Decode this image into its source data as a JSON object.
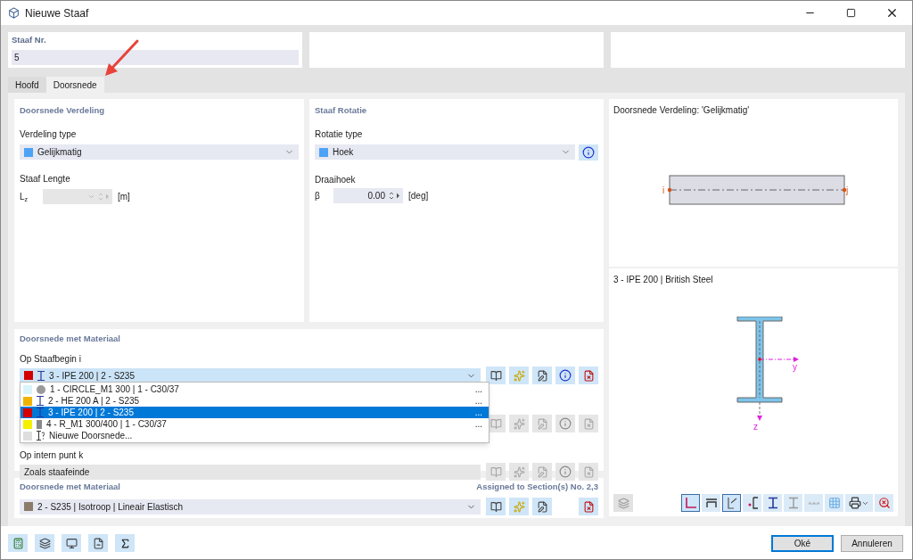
{
  "window": {
    "title": "Nieuwe Staaf"
  },
  "header": {
    "label": "Staaf Nr.",
    "value": "5"
  },
  "tabs": [
    {
      "label": "Hoofd",
      "selected": false
    },
    {
      "label": "Doorsnede",
      "selected": true
    }
  ],
  "distribution": {
    "title": "Doorsnede Verdeling",
    "type_label": "Verdeling type",
    "type_value": "Gelijkmatig",
    "length_label": "Staaf Lengte",
    "length_symbol": "L",
    "length_subscript": "z",
    "length_unit": "[m]"
  },
  "rotation": {
    "title": "Staaf Rotatie",
    "type_label": "Rotatie type",
    "type_value": "Hoek",
    "angle_label": "Draaihoek",
    "angle_symbol": "β",
    "angle_value": "0.00",
    "angle_unit": "[deg]"
  },
  "sections": {
    "title": "Doorsnede met Materiaal",
    "rows": [
      {
        "label": "Op Staafbegin i",
        "value": "3 - IPE 200 | 2 - S235",
        "color": "#d40000",
        "kind": "ibeam",
        "expanded": true,
        "disabled": false
      },
      {
        "disabled": true
      },
      {
        "label": "Op intern punt k",
        "value": "Zoals staafeinde",
        "disabled": true
      }
    ],
    "dropdown": [
      {
        "text": "1 - CIRCLE_M1 300 | 1 - C30/37",
        "color": "#d9f4fb",
        "kind": "circle",
        "selected": false,
        "more": "..."
      },
      {
        "text": "2 - HE 200 A | 2 - S235",
        "color": "#f0b400",
        "kind": "ibeam",
        "selected": false,
        "more": "..."
      },
      {
        "text": "3 - IPE 200 | 2 - S235",
        "color": "#d40000",
        "kind": "ibeam",
        "selected": true,
        "more": "..."
      },
      {
        "text": "4 - R_M1 300/400 | 1 - C30/37",
        "color": "#f5f000",
        "kind": "rect",
        "selected": false,
        "more": "..."
      },
      {
        "text": "Nieuwe Doorsnede...",
        "color": "#dedede",
        "kind": "new",
        "selected": false
      }
    ]
  },
  "material": {
    "title": "Doorsnede met Materiaal",
    "assigned": "Assigned to Section(s) No. 2,3",
    "value": "2 - S235 | Isotroop | Lineair Elastisch",
    "color": "#8c7b6b"
  },
  "preview": {
    "title": "Doorsnede Verdeling: 'Gelijkmatig'",
    "start": "i",
    "end": "j"
  },
  "section_view": {
    "title": "3 - IPE 200 | British Steel",
    "axis_y": "y",
    "axis_z": "z",
    "toolbar": [
      {
        "kind": "axes",
        "selected": true
      },
      {
        "kind": "dimension",
        "selected": false
      },
      {
        "kind": "coords",
        "selected": true
      },
      {
        "kind": "centroid",
        "selected": false
      },
      {
        "kind": "ibeam",
        "selected": false
      },
      {
        "kind": "ibeam-grey",
        "selected": false
      },
      {
        "kind": "numbers",
        "selected": false
      },
      {
        "kind": "grid",
        "selected": false
      },
      {
        "kind": "print",
        "selected": false
      },
      {
        "kind": "zoom",
        "selected": false
      }
    ]
  },
  "footer": {
    "ok": "Oké",
    "cancel": "Annuleren"
  }
}
